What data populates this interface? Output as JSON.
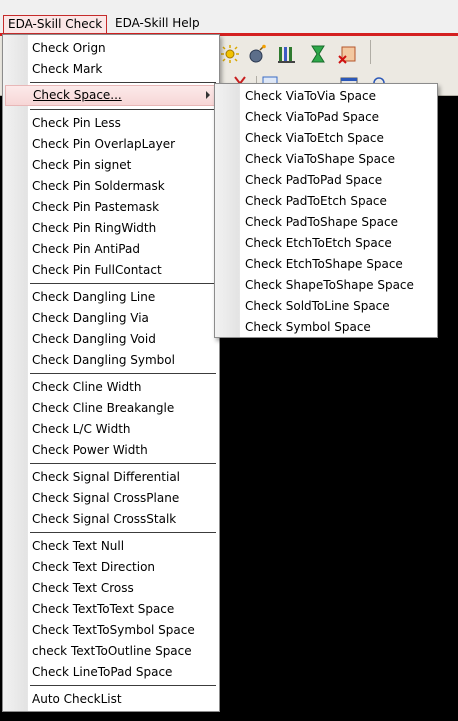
{
  "menubar": {
    "items": [
      {
        "label": "EDA-Skill Check"
      },
      {
        "label": "EDA-Skill Help"
      }
    ]
  },
  "main_menu": {
    "groups": [
      [
        "Check Orign",
        "Check Mark"
      ],
      [
        "Check Space..."
      ],
      [
        "Check Pin Less",
        "Check Pin OverlapLayer",
        "Check Pin signet",
        "Check Pin Soldermask",
        "Check Pin Pastemask",
        "Check Pin RingWidth",
        "Check Pin AntiPad",
        "Check Pin FullContact"
      ],
      [
        "Check Dangling Line",
        "Check Dangling Via",
        "Check Dangling Void",
        "Check Dangling Symbol"
      ],
      [
        "Check Cline Width",
        "Check Cline Breakangle",
        "Check L/C Width",
        "Check Power Width"
      ],
      [
        "Check Signal Differential",
        "Check Signal CrossPlane",
        "Check Signal CrossStalk"
      ],
      [
        "Check Text Null",
        "Check Text Direction",
        "Check Text Cross",
        "Check TextToText Space",
        "Check TextToSymbol Space",
        "check TextToOutline Space",
        "Check LineToPad Space"
      ],
      [
        "Auto CheckList"
      ]
    ],
    "highlighted": "Check Space..."
  },
  "space_submenu": {
    "items": [
      "Check ViaToVia Space",
      "Check ViaToPad Space",
      "Check ViaToEtch Space",
      "Check ViaToShape Space",
      "Check PadToPad Space",
      "Check PadToEtch Space",
      "Check PadToShape Space",
      "Check EtchToEtch Space",
      "Check EtchToShape Space",
      "Check ShapeToShape Space",
      "Check SoldToLine Space",
      "Check Symbol Space"
    ]
  }
}
